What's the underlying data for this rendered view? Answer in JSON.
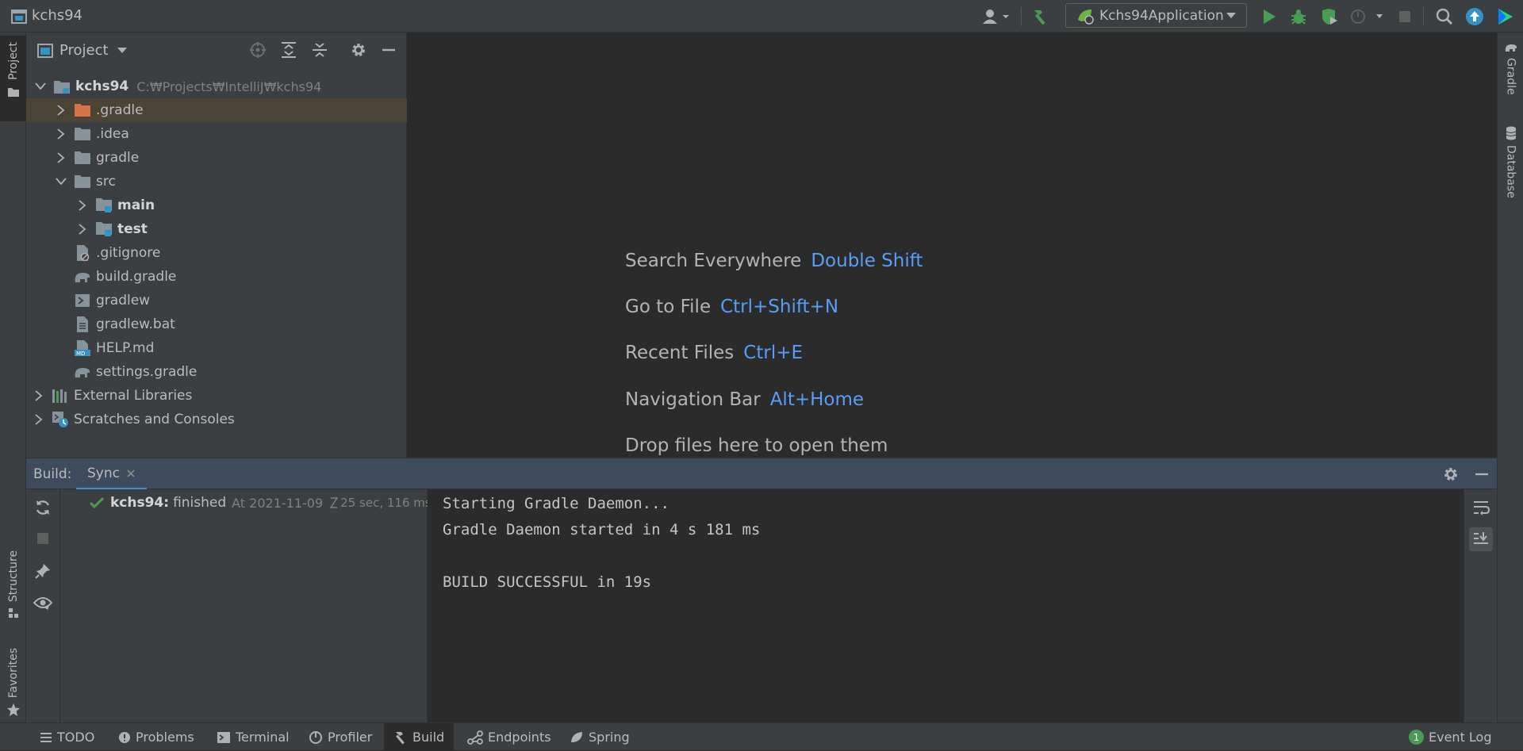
{
  "window": {
    "title": "kchs94"
  },
  "toolbar": {
    "run_config_label": "Kchs94Application",
    "colors": {
      "run": "#499c54",
      "accent": "#3592c4"
    }
  },
  "left_strip": {
    "project_tab": "Project",
    "structure_tab": "Structure",
    "favorites_tab": "Favorites"
  },
  "right_strip": {
    "gradle_tab": "Gradle",
    "database_tab": "Database"
  },
  "project_panel": {
    "title": "Project",
    "root": {
      "name": "kchs94",
      "path": "C:₩Projects₩IntelliJ₩kchs94"
    },
    "items": [
      {
        "label": ".gradle",
        "icon": "folder-excluded-icon"
      },
      {
        "label": ".idea",
        "icon": "folder-icon"
      },
      {
        "label": "gradle",
        "icon": "folder-icon"
      },
      {
        "label": "src",
        "icon": "folder-icon"
      },
      {
        "label": "main",
        "icon": "source-folder-icon"
      },
      {
        "label": "test",
        "icon": "test-folder-icon"
      },
      {
        "label": ".gitignore",
        "icon": "gitignore-file-icon"
      },
      {
        "label": "build.gradle",
        "icon": "gradle-file-icon"
      },
      {
        "label": "gradlew",
        "icon": "shell-file-icon"
      },
      {
        "label": "gradlew.bat",
        "icon": "text-file-icon"
      },
      {
        "label": "HELP.md",
        "icon": "markdown-file-icon"
      },
      {
        "label": "settings.gradle",
        "icon": "gradle-file-icon"
      },
      {
        "label": "External Libraries",
        "icon": "libraries-icon"
      },
      {
        "label": "Scratches and Consoles",
        "icon": "scratches-icon"
      }
    ]
  },
  "editor": {
    "hints": [
      {
        "label": "Search Everywhere",
        "shortcut": "Double Shift"
      },
      {
        "label": "Go to File",
        "shortcut": "Ctrl+Shift+N"
      },
      {
        "label": "Recent Files",
        "shortcut": "Ctrl+E"
      },
      {
        "label": "Navigation Bar",
        "shortcut": "Alt+Home"
      },
      {
        "label": "Drop files here to open them",
        "shortcut": ""
      }
    ]
  },
  "build_panel": {
    "label": "Build:",
    "tab": "Sync",
    "result": {
      "name": "kchs94:",
      "status": "finished",
      "time": "At 2021-11-09",
      "duration": "25 sec, 116 ms"
    },
    "console": [
      "Starting Gradle Daemon...",
      "Gradle Daemon started in 4 s 181 ms",
      "",
      "BUILD SUCCESSFUL in 19s"
    ]
  },
  "status_bar": {
    "items": [
      "TODO",
      "Problems",
      "Terminal",
      "Profiler",
      "Build",
      "Endpoints",
      "Spring"
    ],
    "event_log": {
      "count": "1",
      "label": "Event Log"
    }
  }
}
